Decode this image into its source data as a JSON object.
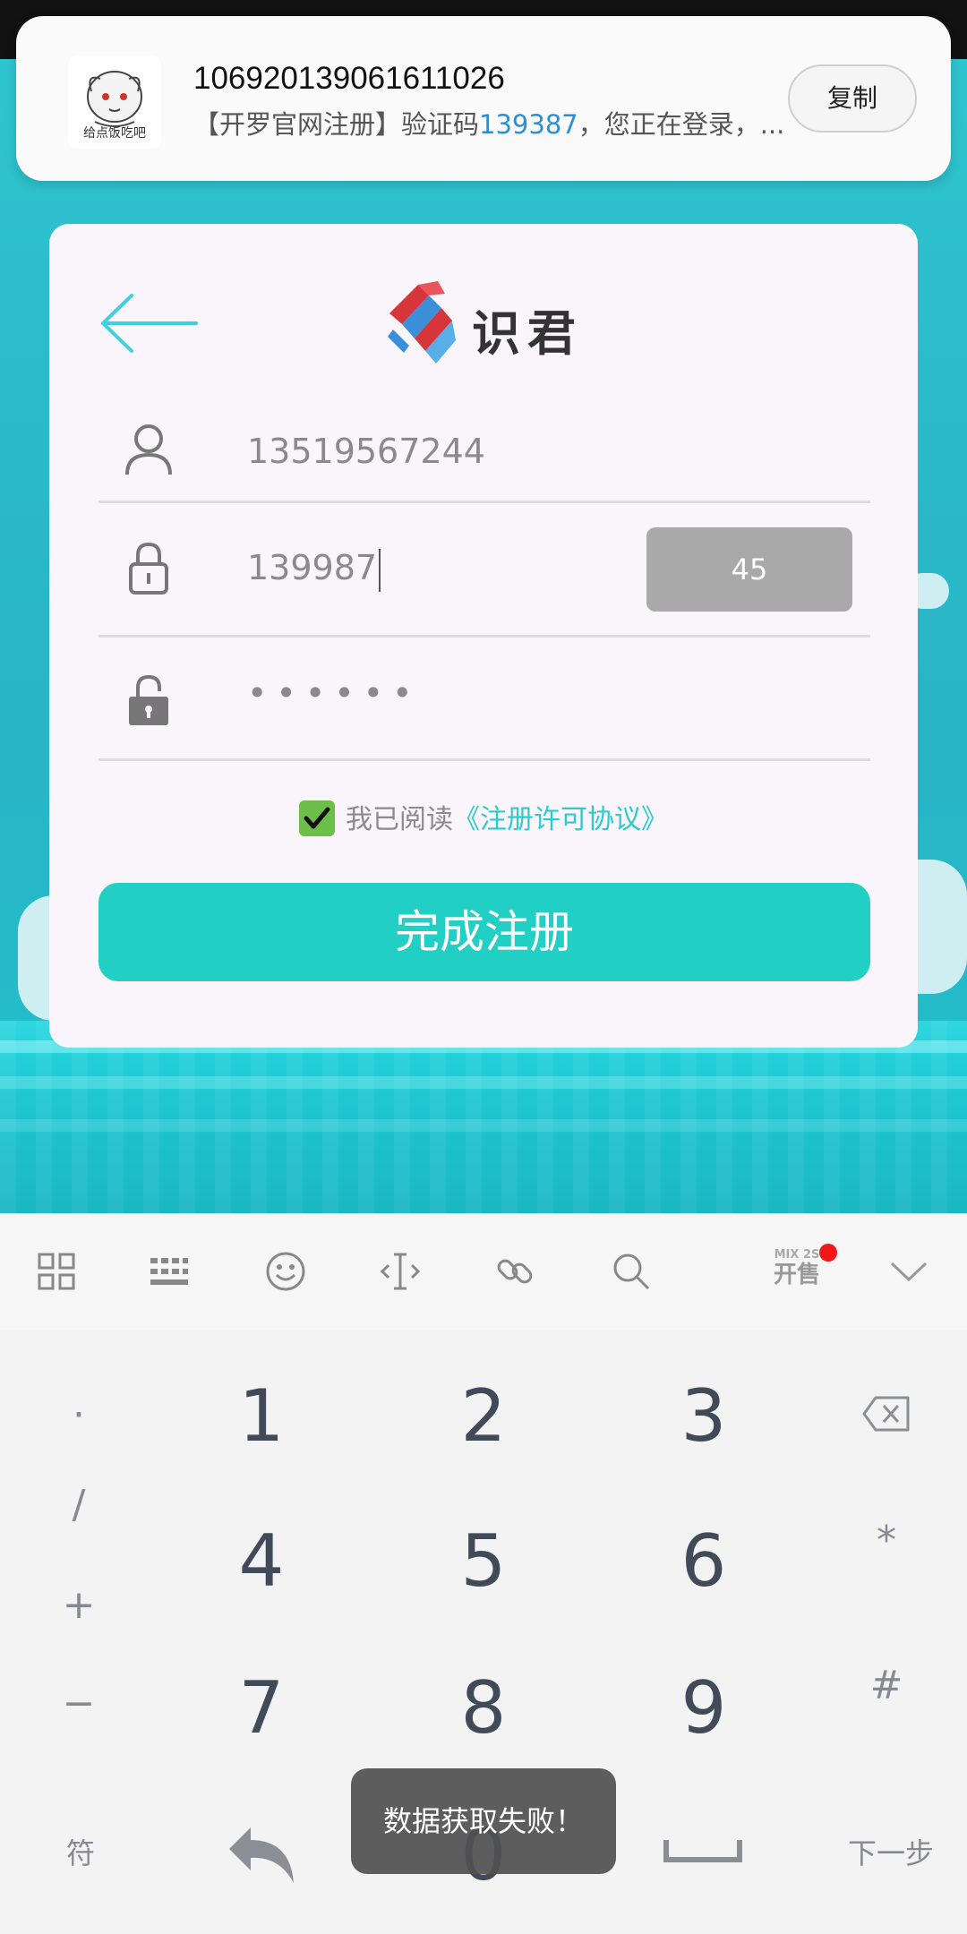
{
  "notification": {
    "sender": "106920139061611026",
    "message_prefix": "【开罗官网注册】验证码",
    "code": "139387",
    "message_suffix": "，您正在登录，...",
    "avatar_caption": "给点饭吃吧",
    "copy_label": "复制"
  },
  "card": {
    "logo_text": "识君",
    "phone_value": "13519567244",
    "code_value": "139987",
    "countdown": "45",
    "password_masked": "••••••",
    "agree_text": "我已阅读",
    "agree_link": "《注册许可协议》",
    "agree_checked": true,
    "submit_label": "完成注册"
  },
  "keyboard": {
    "promo_small": "MIX 2S",
    "promo_big": "开售",
    "digits": [
      "1",
      "2",
      "3",
      "4",
      "5",
      "6",
      "7",
      "8",
      "9",
      "0"
    ],
    "left_keys": [
      "·",
      "/",
      "+",
      "−"
    ],
    "right_keys": [
      "*",
      "#"
    ],
    "symbol_label": "符",
    "next_label": "下一步"
  },
  "toast": {
    "text": "数据获取失败！"
  },
  "colors": {
    "accent": "#22cfc4",
    "link": "#2ecbcb",
    "code_highlight": "#2a8fd6",
    "countdown_bg": "#a9a9a9"
  }
}
